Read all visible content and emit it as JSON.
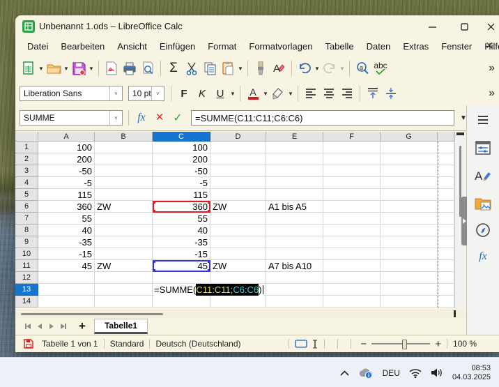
{
  "taskbar": {
    "language": "DEU",
    "time": "08:53",
    "date": "04.03.2025",
    "tray_icons": [
      "tray-expand-chevron",
      "onedrive-cloud",
      "wifi",
      "speaker"
    ]
  },
  "window": {
    "title": "Unbenannt 1.ods – LibreOffice Calc",
    "app_icon": "libreoffice-calc",
    "controls": [
      "minimize",
      "maximize",
      "close"
    ],
    "menus": [
      "Datei",
      "Bearbeiten",
      "Ansicht",
      "Einfügen",
      "Format",
      "Formatvorlagen",
      "Tabelle",
      "Daten",
      "Extras",
      "Fenster",
      "Hilfe"
    ]
  },
  "toolbar_main": {
    "buttons": [
      "new-document",
      "open",
      "save",
      "export-pdf",
      "print",
      "print-preview",
      "sum",
      "cut",
      "copy",
      "paste",
      "clone-formatting",
      "clear-formatting",
      "undo",
      "redo",
      "find-and-replace",
      "spelling"
    ],
    "sum_label": "Σ",
    "clear_label": "A",
    "find_label": "a",
    "spell_label": "abc",
    "overflow": "»"
  },
  "toolbar_format": {
    "font_name": "Liberation Sans",
    "font_size": "10 pt",
    "bold_label": "F",
    "italic_label": "K",
    "underline_label": "U",
    "font_color_label": "A",
    "overflow": "»"
  },
  "formula_bar": {
    "name_box": "SUMME",
    "fx_label": "fx",
    "cancel_glyph": "×",
    "accept_glyph": "✓",
    "formula": "=SUMME(C11:C11;C6:C6)",
    "expand_glyph": "▼"
  },
  "grid": {
    "column_headers": [
      "A",
      "B",
      "C",
      "D",
      "E",
      "F",
      "G"
    ],
    "active_column": "C",
    "active_row": "13",
    "rows": [
      {
        "n": "1",
        "cells": {
          "A": "100",
          "C": "100"
        }
      },
      {
        "n": "2",
        "cells": {
          "A": "200",
          "C": "200"
        }
      },
      {
        "n": "3",
        "cells": {
          "A": "-50",
          "C": "-50"
        }
      },
      {
        "n": "4",
        "cells": {
          "A": "-5",
          "C": "-5"
        }
      },
      {
        "n": "5",
        "cells": {
          "A": "115",
          "C": "115"
        }
      },
      {
        "n": "6",
        "cells": {
          "A": "360",
          "B": "ZW",
          "C": "360",
          "D": "ZW",
          "E": "A1 bis A5"
        }
      },
      {
        "n": "7",
        "cells": {
          "A": "55",
          "C": "55"
        }
      },
      {
        "n": "8",
        "cells": {
          "A": "40",
          "C": "40"
        }
      },
      {
        "n": "9",
        "cells": {
          "A": "-35",
          "C": "-35"
        }
      },
      {
        "n": "10",
        "cells": {
          "A": "-15",
          "C": "-15"
        }
      },
      {
        "n": "11",
        "cells": {
          "A": "45",
          "B": "ZW",
          "C": "45",
          "D": "ZW",
          "E": "A7 bis A10"
        }
      },
      {
        "n": "12",
        "cells": {}
      },
      {
        "n": "13",
        "cells": {}
      },
      {
        "n": "14",
        "cells": {}
      }
    ],
    "editing_cell": {
      "cell": "C13",
      "prefix": "=SUMME(",
      "ref1": "C11:C11",
      "separator": ";",
      "ref2": "C6:C6",
      "suffix": ")",
      "ref1_color": "#e3de4a",
      "ref2_color": "#2bd9e8"
    },
    "reference_outlines": [
      {
        "cell": "C6",
        "color": "#e01b24"
      },
      {
        "cell": "C11",
        "color": "#3434dc"
      }
    ]
  },
  "sheet_tabs": {
    "add_label": "+",
    "tabs": [
      {
        "label": "Tabelle1",
        "active": true
      }
    ]
  },
  "status_bar": {
    "sheet_info": "Tabelle 1 von 1",
    "page_style": "Standard",
    "language": "Deutsch (Deutschland)",
    "zoom_minus": "−",
    "zoom_plus": "+",
    "zoom_level": "100 %"
  },
  "colors": {
    "accent_blue": "#1576d2",
    "chrome": "#f8f4e3",
    "save_modified_red": "#cc2222"
  }
}
